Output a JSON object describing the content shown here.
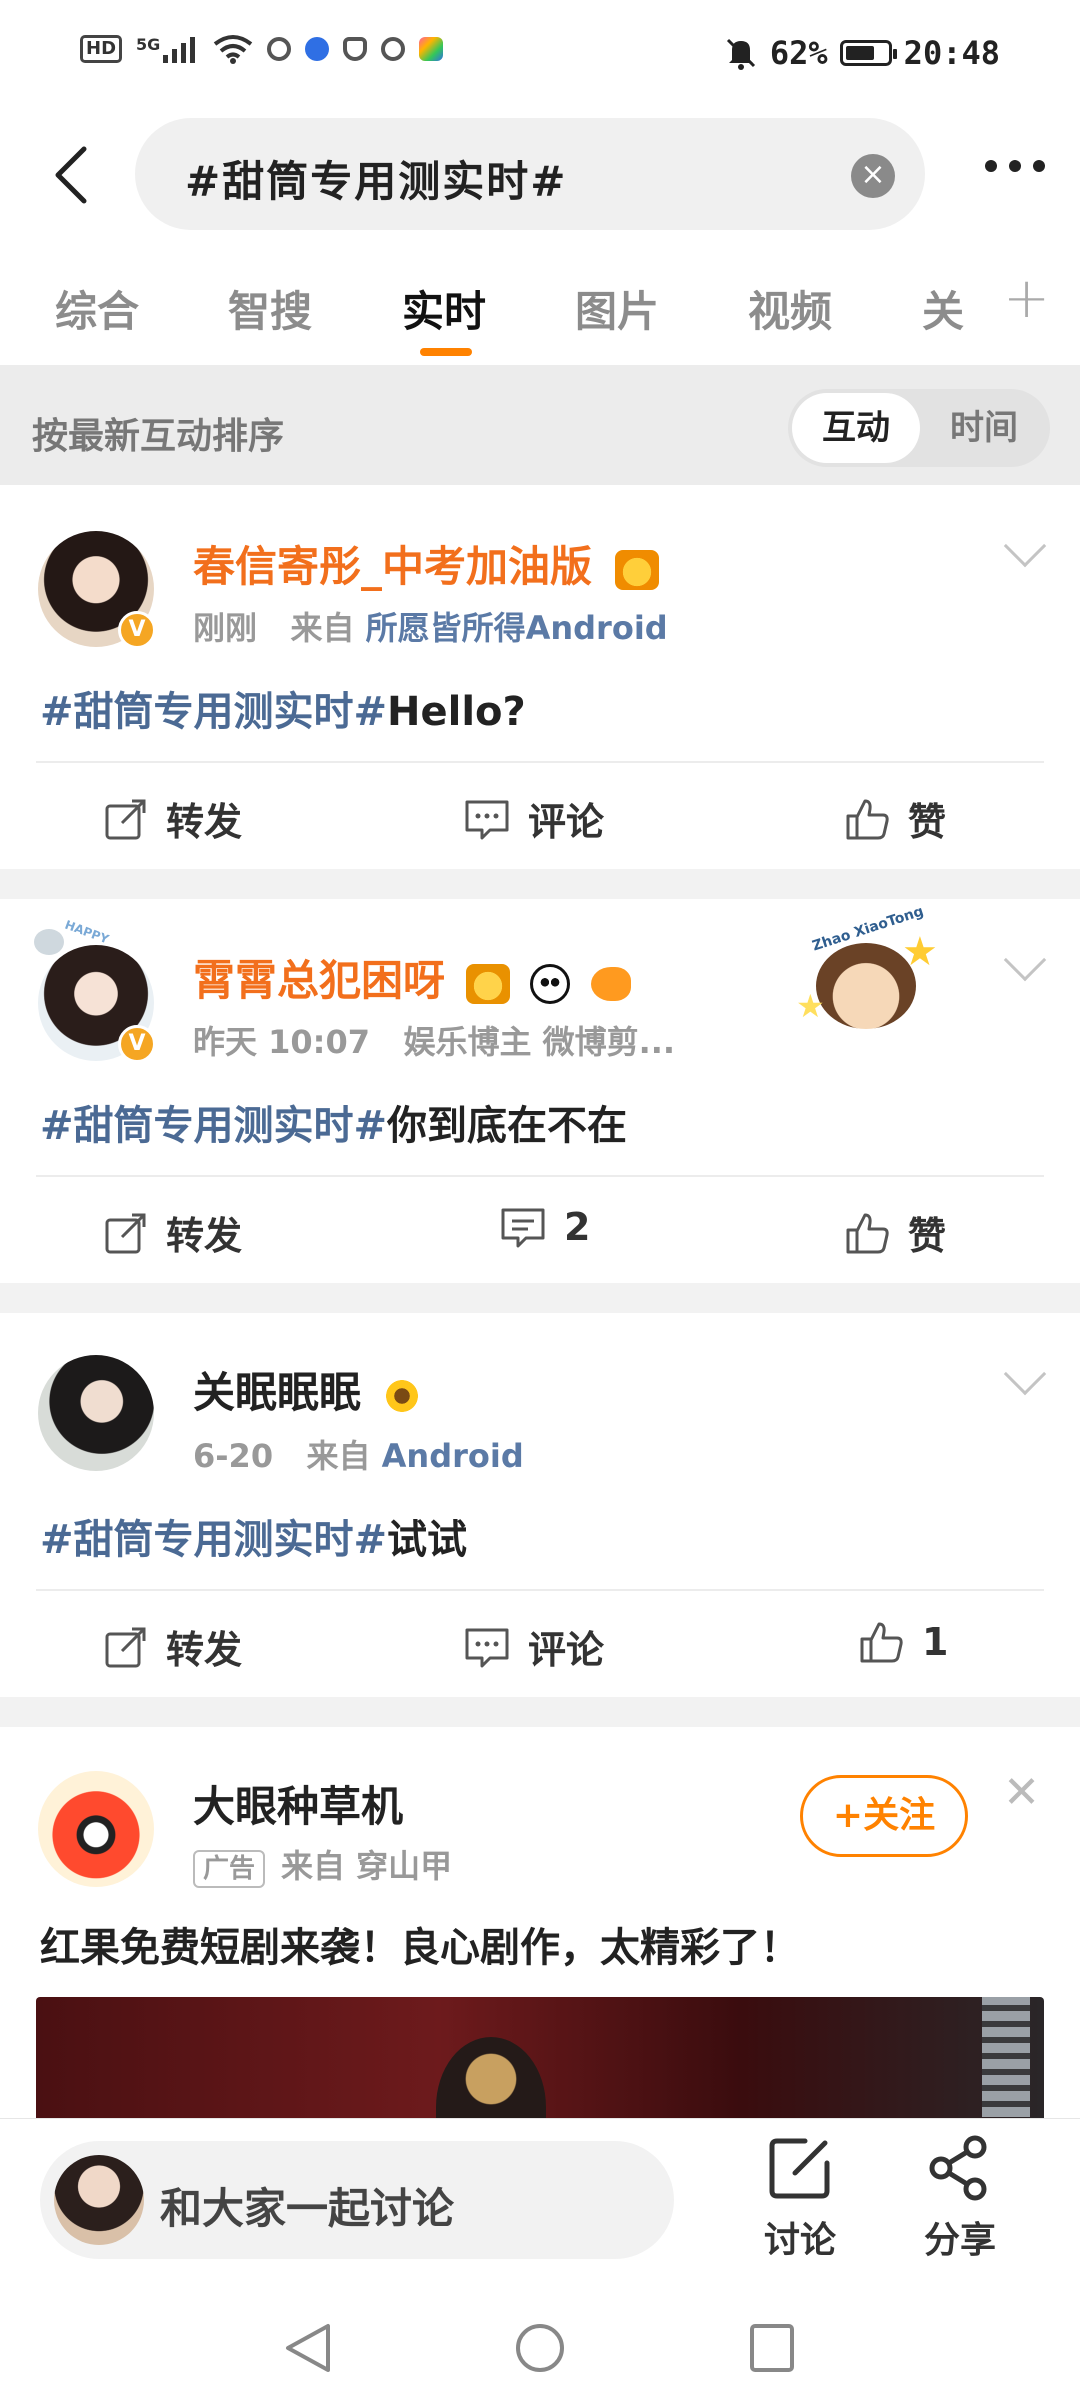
{
  "status_bar": {
    "network": "HD",
    "signal": "5G",
    "battery": "62%",
    "time": "20:48"
  },
  "search": {
    "query": "#甜筒专用测实时#"
  },
  "tabs": [
    {
      "label": "综合"
    },
    {
      "label": "智搜"
    },
    {
      "label": "实时"
    },
    {
      "label": "图片"
    },
    {
      "label": "视频"
    },
    {
      "label": "关"
    }
  ],
  "active_tab": "实时",
  "sort": {
    "label": "按最新互动排序",
    "option_active": "互动",
    "option_inactive": "时间"
  },
  "posts": [
    {
      "username": "春信寄彤_中考加油版",
      "time": "刚刚",
      "source_prefix": "来自",
      "source": "所愿皆所得Android",
      "topic": "#甜筒专用测实时#",
      "text": "Hello?",
      "repost": "转发",
      "comment": "评论",
      "like": "赞"
    },
    {
      "username": "霄霄总犯困呀",
      "time": "昨天 10:07",
      "tags": "娱乐博主 微博剪...",
      "topic": "#甜筒专用测实时#",
      "text": "你到底在不在",
      "repost": "转发",
      "comment": "2",
      "like": "赞",
      "sticker_text": "Zhao XiaoTong",
      "avatar_sticker_text": "HAPPY"
    },
    {
      "username": "关眠眠眠",
      "time": "6-20",
      "source_prefix": "来自",
      "source": "Android",
      "topic": "#甜筒专用测实时#",
      "text": "试试",
      "repost": "转发",
      "comment": "评论",
      "like": "1"
    }
  ],
  "ad": {
    "username": "大眼种草机",
    "ad_tag": "广告",
    "source_prefix": "来自",
    "source": "穿山甲",
    "follow": "+关注",
    "text": "红果免费短剧来袭！良心剧作，太精彩了！"
  },
  "bottom_bar": {
    "input_placeholder": "和大家一起讨论",
    "discuss": "讨论",
    "share": "分享"
  },
  "colors": {
    "accent": "#ff8200",
    "username_orange": "#f26f1c",
    "topic_blue": "#4b6a94"
  }
}
